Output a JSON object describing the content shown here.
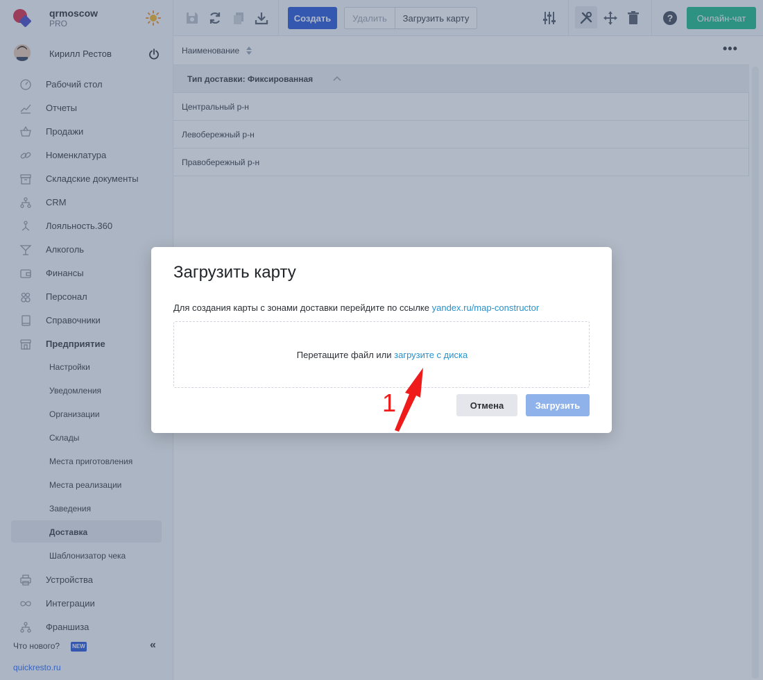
{
  "brand": {
    "name": "qrmoscow",
    "plan": "PRO"
  },
  "user": {
    "name": "Кирилл Рестов"
  },
  "sidebar": {
    "items": [
      {
        "label": "Рабочий стол",
        "icon": "dashboard-icon"
      },
      {
        "label": "Отчеты",
        "icon": "chart-icon"
      },
      {
        "label": "Продажи",
        "icon": "basket-icon"
      },
      {
        "label": "Номенклатура",
        "icon": "link-icon"
      },
      {
        "label": "Складские документы",
        "icon": "archive-icon"
      },
      {
        "label": "CRM",
        "icon": "hierarchy-icon"
      },
      {
        "label": "Лояльность.360",
        "icon": "loyalty-icon"
      },
      {
        "label": "Алкоголь",
        "icon": "cocktail-icon"
      },
      {
        "label": "Финансы",
        "icon": "wallet-icon"
      },
      {
        "label": "Персонал",
        "icon": "people-icon"
      },
      {
        "label": "Справочники",
        "icon": "book-icon"
      },
      {
        "label": "Предприятие",
        "icon": "store-icon"
      }
    ],
    "subitems": [
      {
        "label": "Настройки"
      },
      {
        "label": "Уведомления"
      },
      {
        "label": "Организации"
      },
      {
        "label": "Склады"
      },
      {
        "label": "Места приготовления"
      },
      {
        "label": "Места реализации"
      },
      {
        "label": "Заведения"
      },
      {
        "label": "Доставка"
      },
      {
        "label": "Шаблонизатор чека"
      }
    ],
    "items_after": [
      {
        "label": "Устройства",
        "icon": "printer-icon"
      },
      {
        "label": "Интеграции",
        "icon": "infinity-icon"
      },
      {
        "label": "Франшиза",
        "icon": "hierarchy-icon"
      }
    ],
    "whats_new": "Что нового?",
    "new_badge": "NEW",
    "footer_link": "quickresto.ru"
  },
  "toolbar": {
    "create": "Создать",
    "delete": "Удалить",
    "load_map": "Загрузить карту",
    "online_chat": "Онлайн-чат"
  },
  "table": {
    "column": "Наименование",
    "group": "Тип доставки: Фиксированная",
    "rows": [
      "Центральный р-н",
      "Левобережный р-н",
      "Правобережный р-н"
    ]
  },
  "modal": {
    "title": "Загрузить карту",
    "desc_text": "Для создания карты с зонами доставки перейдите по ссылке",
    "desc_link": "yandex.ru/map-constructor",
    "drop_text": "Перетащите файл или",
    "drop_link": "загрузите с диска",
    "cancel": "Отмена",
    "upload": "Загрузить"
  },
  "annotation": {
    "number": "1"
  },
  "colors": {
    "primary": "#1d4ed8",
    "success": "#10b981",
    "link": "#2a90c9",
    "annotation": "#ef1b1b"
  }
}
